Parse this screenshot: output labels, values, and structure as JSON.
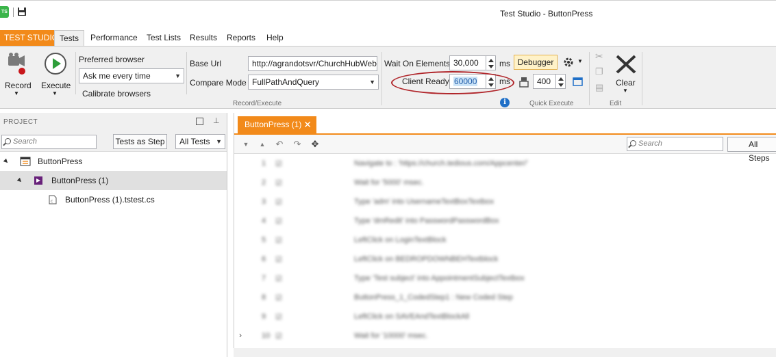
{
  "window": {
    "title": "Test Studio - ButtonPress",
    "logo_text": "TS"
  },
  "menu": {
    "brand": "TEST STUDIO",
    "tabs": [
      "Tests",
      "Performance",
      "Test Lists",
      "Results",
      "Reports",
      "Help"
    ],
    "active_tab": "Tests"
  },
  "ribbon": {
    "record_label": "Record",
    "execute_label": "Execute",
    "preferred_browser_label": "Preferred browser",
    "preferred_browser_value": "Ask me every time",
    "calibrate_label": "Calibrate browsers",
    "base_url_label": "Base Url",
    "base_url_value": "http://agrandotsvr/ChurchHubWeb",
    "compare_mode_label": "Compare Mode",
    "compare_mode_value": "FullPathAndQuery",
    "group_record_execute": "Record/Execute",
    "wait_elements_label": "Wait On Elements",
    "wait_elements_value": "30,000",
    "wait_elements_unit": "ms",
    "client_ready_label": "Client Ready",
    "client_ready_value": "60000",
    "client_ready_unit": "ms",
    "debugger_label": "Debugger",
    "quick_value": "400",
    "group_quick_execute": "Quick Execute",
    "clear_label": "Clear",
    "group_edit": "Edit",
    "highlight_color": "#b0252a",
    "accent_color": "#f28a1a"
  },
  "project": {
    "title": "PROJECT",
    "search_placeholder": "Search",
    "tests_as_step": "Tests as Step",
    "filter_value": "All Tests",
    "tree": [
      {
        "label": "ButtonPress",
        "level": 0,
        "icon": "project-icon"
      },
      {
        "label": "ButtonPress (1)",
        "level": 1,
        "icon": "test-icon"
      },
      {
        "label": "ButtonPress (1).tstest.cs",
        "level": 2,
        "icon": "code-file-icon"
      }
    ]
  },
  "editor": {
    "tab_label": "ButtonPress (1)",
    "search_placeholder": "Search",
    "filter_value": "All Steps",
    "steps": [
      {
        "num": "1",
        "text": "Navigate to : 'https://church.tedious.com/Appcenter/'"
      },
      {
        "num": "2",
        "text": "Wait for '5000' msec."
      },
      {
        "num": "3",
        "text": "Type 'adm' into UsernameTextBoxTextbox"
      },
      {
        "num": "4",
        "text": "Type 'dmRedit' into PasswordPasswordBox"
      },
      {
        "num": "5",
        "text": "LeftClick on LoginTextBlock"
      },
      {
        "num": "6",
        "text": "LeftClick on BEDROPDOWNBEHTextblock"
      },
      {
        "num": "7",
        "text": "Type 'Test subject' into AppointmentSubjectTextbox"
      },
      {
        "num": "8",
        "text": "ButtonPress_1_CodedStep1 : New Coded Step"
      },
      {
        "num": "9",
        "text": "LeftClick on SAVEAndTextBlockAll"
      },
      {
        "num": "10",
        "text": "Wait for '10000' msec."
      }
    ]
  }
}
